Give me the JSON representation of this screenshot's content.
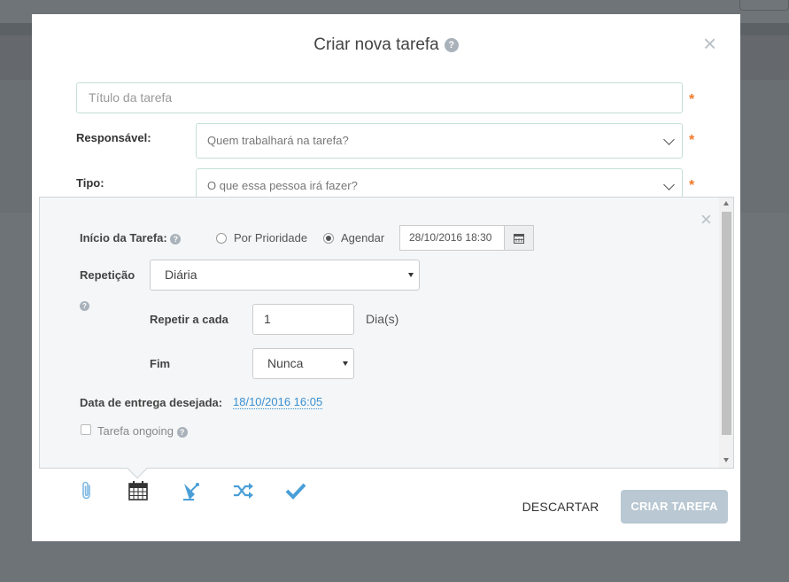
{
  "modal": {
    "title": "Criar nova tarefa",
    "help": "?",
    "close": "×"
  },
  "form": {
    "title_placeholder": "Título da tarefa",
    "required_mark": "*",
    "responsavel_label": "Responsável:",
    "responsavel_placeholder": "Quem trabalhará na tarefa?",
    "tipo_label": "Tipo:",
    "tipo_placeholder": "O que essa pessoa irá fazer?"
  },
  "schedule": {
    "close": "×",
    "inicio_label": "Início da Tarefa:",
    "radio_prioridade": "Por Prioridade",
    "radio_agendar": "Agendar",
    "selected_radio": "Agendar",
    "date_value": "28/10/2016 18:30",
    "repeticao_label": "Repetição",
    "repeticao_value": "Diária",
    "repetir_label": "Repetir a cada",
    "repetir_value": "1",
    "repetir_unit": "Dia(s)",
    "fim_label": "Fim",
    "fim_value": "Nunca",
    "entrega_label": "Data de entrega desejada:",
    "entrega_value": "18/10/2016 16:05",
    "ongoing_label": "Tarefa ongoing"
  },
  "toolbar": {
    "icons": [
      "paperclip-icon",
      "calendar-icon",
      "satellite-icon",
      "shuffle-icon",
      "check-icon"
    ],
    "discard_label": "DESCARTAR",
    "create_label": "CRIAR TAREFA"
  },
  "colors": {
    "accent_blue": "#4a9fd8",
    "required_orange": "#f07a2a",
    "create_button_disabled": "#b9c8d2",
    "link_blue": "#3a8fd0"
  }
}
